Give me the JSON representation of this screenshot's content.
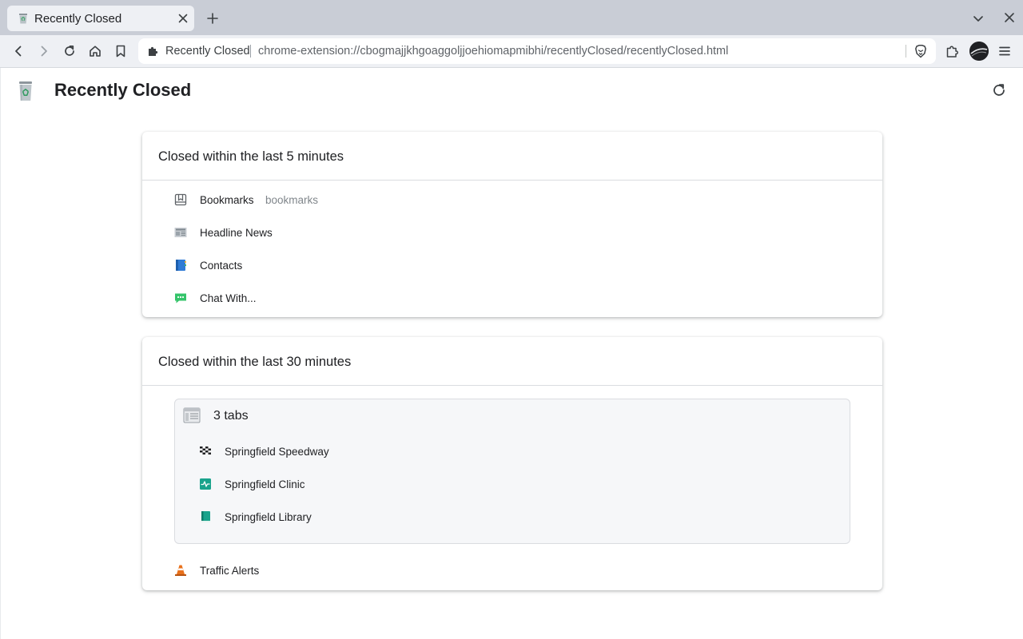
{
  "browser": {
    "tab": {
      "title": "Recently Closed"
    },
    "omnibox": {
      "site_name": "Recently Closed",
      "url": "chrome-extension://cbogmajjkhgoaggoljjoehiomapmibhi/recentlyClosed/recentlyClosed.html"
    },
    "icons": [
      "back-icon",
      "forward-icon",
      "reload-icon",
      "home-icon",
      "bookmark-icon",
      "puzzle-icon",
      "brave-lion-icon",
      "menu-icon",
      "chevron-down-icon",
      "close-icon",
      "plus-icon"
    ]
  },
  "page": {
    "title": "Recently Closed",
    "logo_icon": "recycle-bin-icon",
    "refresh_icon": "refresh-icon"
  },
  "sections": [
    {
      "title": "Closed within the last 5 minutes",
      "items": [
        {
          "title": "Bookmarks",
          "url": "bookmarks",
          "icon": "bookmark-outline-icon"
        },
        {
          "title": "Headline News",
          "icon": "newspaper-icon"
        },
        {
          "title": "Contacts",
          "icon": "address-book-icon"
        },
        {
          "title": "Chat With...",
          "icon": "chat-bubble-icon"
        }
      ]
    },
    {
      "title": "Closed within the last 30 minutes",
      "group": {
        "title": "3 tabs",
        "icon": "window-icon",
        "items": [
          {
            "title": "Springfield Speedway",
            "icon": "checkered-flag-icon"
          },
          {
            "title": "Springfield Clinic",
            "icon": "heartbeat-icon"
          },
          {
            "title": "Springfield Library",
            "icon": "book-icon"
          }
        ]
      },
      "items": [
        {
          "title": "Traffic Alerts",
          "icon": "traffic-cone-icon"
        }
      ]
    }
  ],
  "colors": {
    "tabstrip_bg": "#c9cdd6",
    "toolbar_bg": "#eef0f4",
    "chat_green": "#34c46a",
    "library_teal": "#1aa38c",
    "cone_orange": "#e8711c",
    "contacts_blue": "#2f7bd6"
  }
}
